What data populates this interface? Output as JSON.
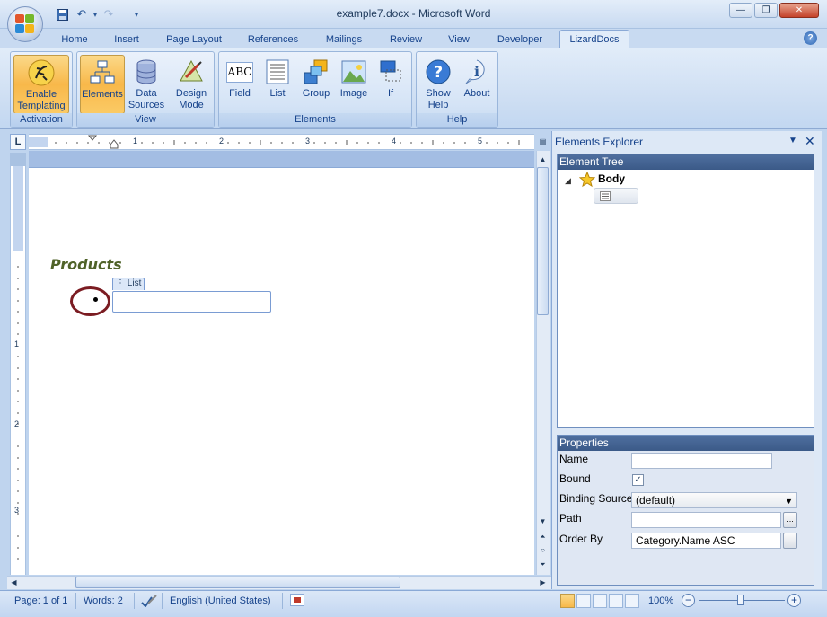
{
  "window": {
    "title": "example7.docx - Microsoft Word",
    "minimize": "—",
    "restore": "❐",
    "close": "✕"
  },
  "qat": {
    "save_icon": "save-icon",
    "undo_icon": "undo-icon",
    "redo_icon": "redo-icon",
    "customize_icon": "dropdown-icon"
  },
  "tabs": [
    {
      "label": "Home"
    },
    {
      "label": "Insert"
    },
    {
      "label": "Page Layout"
    },
    {
      "label": "References"
    },
    {
      "label": "Mailings"
    },
    {
      "label": "Review"
    },
    {
      "label": "View"
    },
    {
      "label": "Developer"
    },
    {
      "label": "LizardDocs"
    }
  ],
  "ribbon": {
    "groups": [
      {
        "label": "Activation",
        "buttons": [
          {
            "line1": "Enable",
            "line2": "Templating"
          }
        ]
      },
      {
        "label": "View",
        "buttons": [
          {
            "line1": "Elements",
            "line2": ""
          },
          {
            "line1": "Data",
            "line2": "Sources"
          },
          {
            "line1": "Design",
            "line2": "Mode"
          }
        ]
      },
      {
        "label": "Elements",
        "buttons": [
          {
            "line1": "Field",
            "line2": ""
          },
          {
            "line1": "List",
            "line2": ""
          },
          {
            "line1": "Group",
            "line2": ""
          },
          {
            "line1": "Image",
            "line2": ""
          },
          {
            "line1": "If",
            "line2": ""
          }
        ]
      },
      {
        "label": "Help",
        "buttons": [
          {
            "line1": "Show",
            "line2": "Help"
          },
          {
            "line1": "About",
            "line2": ""
          }
        ]
      }
    ],
    "field_icon_text": "ABC"
  },
  "ruler": {
    "numbers": [
      "1",
      "2",
      "3",
      "4",
      "5"
    ],
    "vnumbers": [
      "1",
      "2",
      "3"
    ]
  },
  "document": {
    "heading": "Products",
    "list_tag": "List"
  },
  "explorer": {
    "title": "Elements Explorer",
    "tree_header": "Element Tree",
    "root_node": "Body",
    "properties_header": "Properties",
    "properties": {
      "name_label": "Name",
      "name_value": "",
      "bound_label": "Bound",
      "bound_checked": true,
      "binding_source_label": "Binding Source",
      "binding_source_value": "(default)",
      "path_label": "Path",
      "path_value": "",
      "order_by_label": "Order By",
      "order_by_value": "Category.Name ASC",
      "ellipsis": "..."
    }
  },
  "status": {
    "page": "Page: 1 of 1",
    "words": "Words: 2",
    "language": "English (United States)",
    "zoom": "100%",
    "zoom_out": "−",
    "zoom_in": "+"
  },
  "colors": {
    "accent": "#15428b",
    "heading": "#4f6228",
    "highlight_circle": "#7b1c22"
  }
}
